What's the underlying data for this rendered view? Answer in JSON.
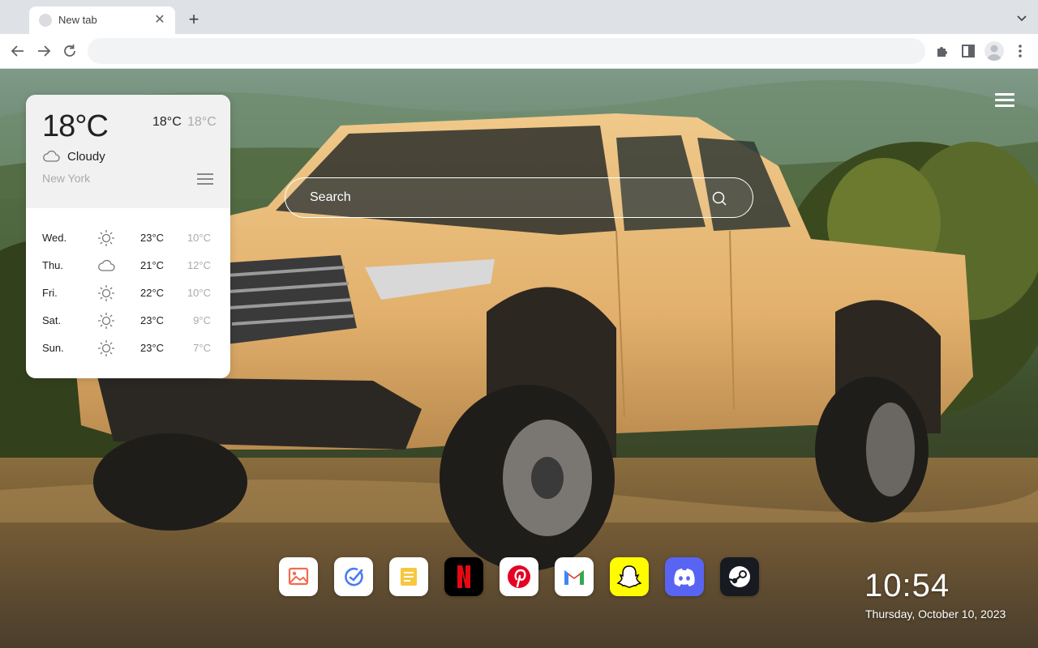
{
  "browser": {
    "tab": {
      "title": "New tab",
      "close": "✕"
    },
    "new_tab_label": "+",
    "omnibox": {
      "value": "",
      "placeholder": ""
    }
  },
  "weather": {
    "current_temp": "18°C",
    "high": "18°C",
    "low": "18°C",
    "condition": "Cloudy",
    "condition_icon": "cloud-icon",
    "city": "New York",
    "forecast": [
      {
        "day": "Wed.",
        "icon": "sun-icon",
        "high": "23°C",
        "low": "10°C"
      },
      {
        "day": "Thu.",
        "icon": "cloud-icon",
        "high": "21°C",
        "low": "12°C"
      },
      {
        "day": "Fri.",
        "icon": "sun-icon",
        "high": "22°C",
        "low": "10°C"
      },
      {
        "day": "Sat.",
        "icon": "sun-icon",
        "high": "23°C",
        "low": "9°C"
      },
      {
        "day": "Sun.",
        "icon": "sun-icon",
        "high": "23°C",
        "low": "7°C"
      }
    ]
  },
  "search": {
    "placeholder": "Search"
  },
  "dock": [
    {
      "name": "photos",
      "icon": "image-icon"
    },
    {
      "name": "tasks",
      "icon": "check-circle-icon"
    },
    {
      "name": "notes",
      "icon": "note-icon"
    },
    {
      "name": "netflix",
      "icon": "netflix-icon"
    },
    {
      "name": "pinterest",
      "icon": "pinterest-icon"
    },
    {
      "name": "gmail",
      "icon": "gmail-icon"
    },
    {
      "name": "snapchat",
      "icon": "snapchat-icon"
    },
    {
      "name": "discord",
      "icon": "discord-icon"
    },
    {
      "name": "steam",
      "icon": "steam-icon"
    }
  ],
  "clock": {
    "time": "10:54",
    "date": "Thursday, October 10, 2023"
  },
  "colors": {
    "accent": "#4285f4",
    "netflix": "#e50914",
    "pinterest": "#e60023",
    "snapchat": "#fffc00",
    "discord": "#5865f2",
    "steam": "#171a21"
  }
}
